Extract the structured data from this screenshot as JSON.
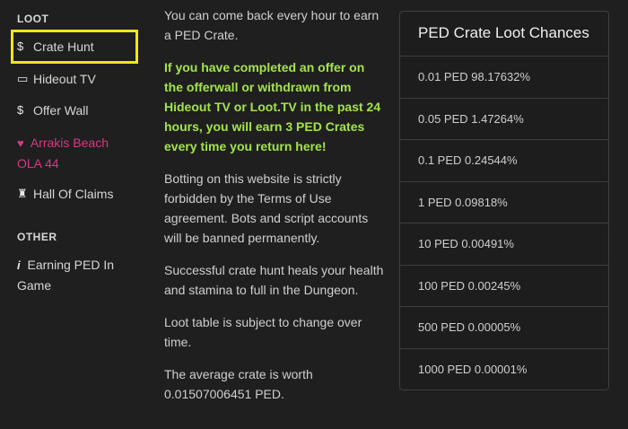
{
  "sidebar": {
    "loot_title": "LOOT",
    "other_title": "OTHER",
    "items": [
      {
        "icon": "$",
        "label": "Crate Hunt"
      },
      {
        "icon": "▭",
        "label": "Hideout TV"
      },
      {
        "icon": "$",
        "label": "Offer Wall"
      },
      {
        "icon": "♥",
        "label": "Arrakis Beach OLA 44"
      },
      {
        "icon": "♜",
        "label": "Hall Of Claims"
      },
      {
        "icon": "i",
        "label": "Earning PED In Game"
      }
    ],
    "highlight_color": "#f1e51c",
    "pink_color": "#d63a82"
  },
  "main": {
    "p1": "You can come back every hour to earn a PED Crate.",
    "p2": "If you have completed an offer on the offerwall or withdrawn from Hideout TV or Loot.TV in the past 24 hours, you will earn 3 PED Crates every time you return here!",
    "p3": "Botting on this website is strictly forbidden by the Terms of Use agreement. Bots and script accounts will be banned permanently.",
    "p4": "Successful crate hunt heals your health and stamina to full in the Dungeon.",
    "p5": "Loot table is subject to change over time.",
    "p6": "The average crate is worth 0.01507006451 PED.",
    "green_color": "#a4e34b"
  },
  "loot_table": {
    "title": "PED Crate Loot Chances",
    "rows": [
      "0.01 PED 98.17632%",
      "0.05 PED 1.47264%",
      "0.1 PED 0.24544%",
      "1 PED 0.09818%",
      "10 PED 0.00491%",
      "100 PED 0.00245%",
      "500 PED 0.00005%",
      "1000 PED 0.00001%"
    ]
  }
}
